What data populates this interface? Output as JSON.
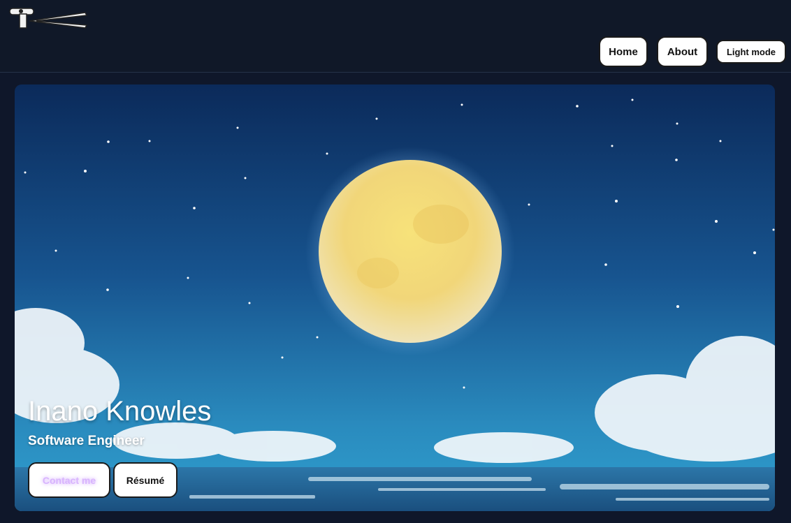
{
  "header": {
    "logo_icon": "initials-logo-icon",
    "nav": {
      "home_label": "Home",
      "about_label": "About",
      "theme_toggle_label": "Light mode"
    }
  },
  "hero": {
    "background": "night-sky-full-moon-over-ocean",
    "name": "Inano Knowles",
    "role": "Software Engineer",
    "buttons": {
      "contact_label": "Contact me",
      "resume_label": "Résumé"
    }
  },
  "colors": {
    "page_bg": "#0f172a",
    "header_bg": "#101828",
    "button_bg": "#ffffff",
    "contact_text": "#d8b4fe",
    "moon": "#f3df7c",
    "sky_top": "#0b2a5a",
    "sky_bottom": "#2a8bbe"
  }
}
